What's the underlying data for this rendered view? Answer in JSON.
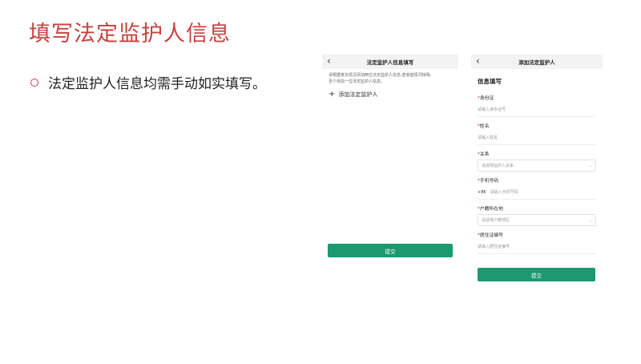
{
  "slide": {
    "title": "填写法定监护人信息",
    "bullet": "法定监护人信息均需手动如实填写。"
  },
  "screen1": {
    "title": "法定监护人信息填写",
    "desc_line1": "请根据真实情况添加两位法定监护人信息;若家庭情况特殊,",
    "desc_line2": "至少添加一位法定监护人信息。",
    "add_label": "添加法定监护人",
    "submit": "提交"
  },
  "screen2": {
    "title": "添加法定监护人",
    "section": "信息填写",
    "id_label": "身份证",
    "id_placeholder": "请输入身份证号",
    "name_label": "姓名",
    "name_placeholder": "请输入姓名",
    "relation_label": "关系",
    "relation_placeholder": "请选择监护人关系",
    "phone_label": "手机号码",
    "phone_prefix": "+86",
    "phone_placeholder": "请输入手机号码",
    "hukou_label": "户籍所在地",
    "hukou_placeholder": "请选择户籍地区",
    "residence_label": "居住证编号",
    "residence_placeholder": "请输入居住证编号",
    "required_mark": "*",
    "submit": "提交"
  },
  "icons": {
    "back": "chevron-left-icon",
    "add": "plus-icon",
    "dropdown": "chevron-down-icon"
  },
  "colors": {
    "title": "#c9413f",
    "primary_button": "#1a9a6e",
    "required": "#e03c31"
  }
}
